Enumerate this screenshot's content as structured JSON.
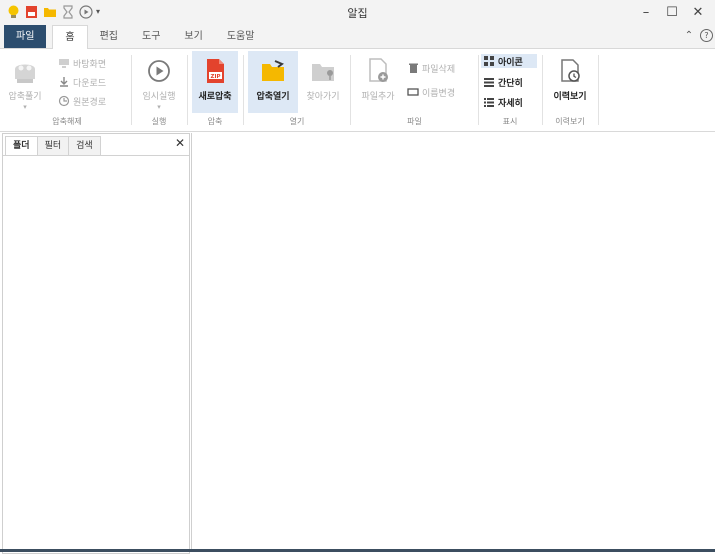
{
  "window": {
    "title": "알집"
  },
  "quick_access": {
    "icons": [
      "yellow-bulb-icon",
      "red-archive-icon",
      "folder-icon",
      "hourglass-icon",
      "play-circle-icon"
    ],
    "dropdown_glyph": "▾"
  },
  "window_controls": {
    "minimize": "–",
    "maximize": "☐",
    "close": "✕"
  },
  "menu_tabs": [
    {
      "label": "파일"
    },
    {
      "label": "홈"
    },
    {
      "label": "편집"
    },
    {
      "label": "도구"
    },
    {
      "label": "보기"
    },
    {
      "label": "도움말"
    }
  ],
  "tabbar_right": {
    "collapse_glyph": "⌃",
    "help_glyph": "?"
  },
  "ribbon": {
    "extract": {
      "big_label": "압축풀기",
      "small": [
        {
          "label": "바탕화면"
        },
        {
          "label": "다운로드"
        },
        {
          "label": "원본경로"
        }
      ],
      "group_label": "압축해제"
    },
    "run": {
      "label": "임시실행",
      "group_label": "실행"
    },
    "compress": {
      "label": "새로압축",
      "badge": "ZIP",
      "group_label": "압축"
    },
    "open": {
      "open_label": "압축열기",
      "find_label": "찾아가기",
      "group_label": "열기"
    },
    "file": {
      "add_label": "파일추가",
      "delete_label": "파일삭제",
      "rename_label": "이름변경",
      "group_label": "파일"
    },
    "view": {
      "items": [
        {
          "label": "아이콘"
        },
        {
          "label": "간단히"
        },
        {
          "label": "자세히"
        }
      ],
      "group_label": "표시"
    },
    "history": {
      "label": "이력보기",
      "group_label": "이력보기"
    }
  },
  "left_panel": {
    "tabs": [
      {
        "label": "폴더"
      },
      {
        "label": "필터"
      },
      {
        "label": "검색"
      }
    ],
    "close_glyph": "✕"
  },
  "colors": {
    "file_tab_bg": "#2c4d6e",
    "selected_bg": "#dde8f5",
    "folder_yellow": "#f5b800",
    "zip_red": "#e3432d",
    "disabled_text": "#b0b0b0"
  }
}
